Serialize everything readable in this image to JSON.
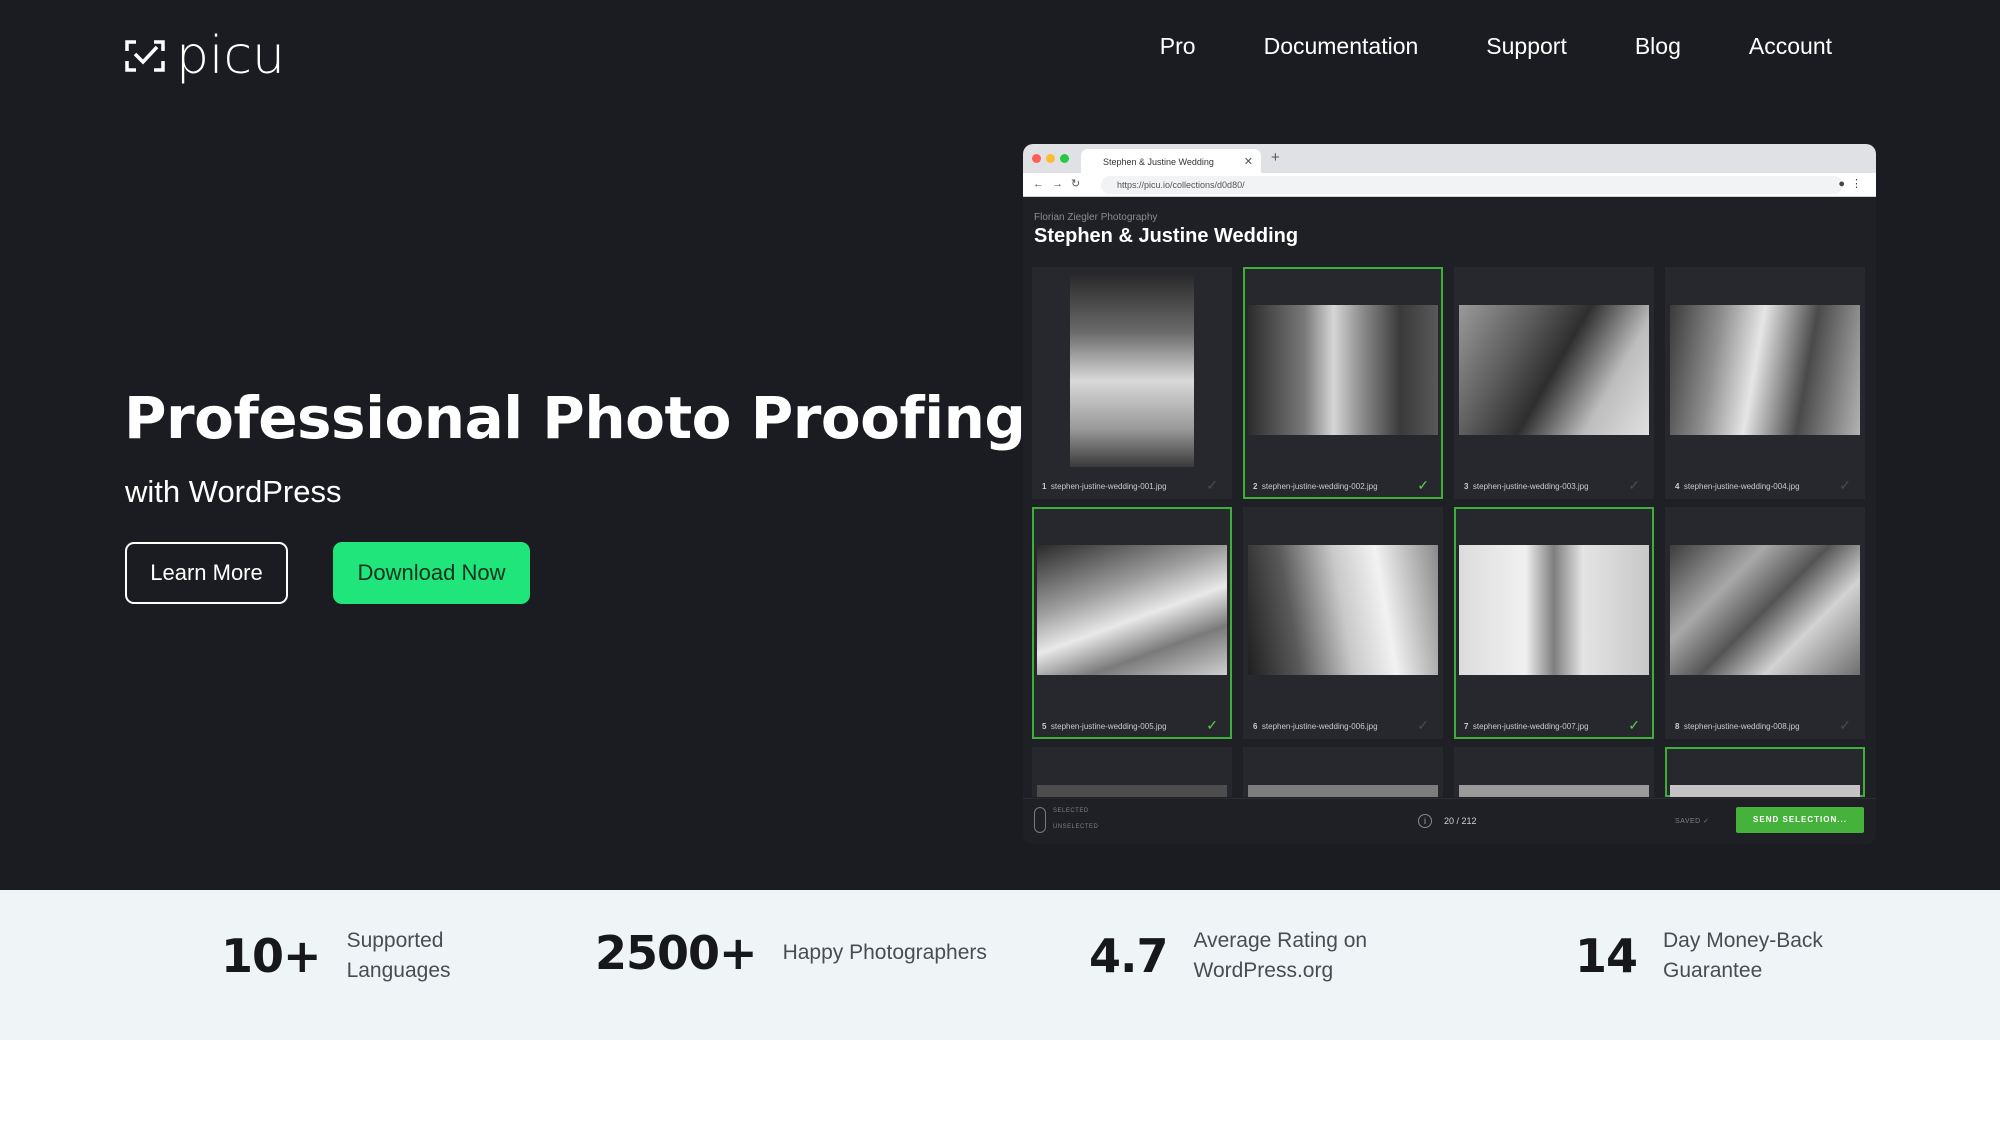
{
  "header": {
    "logo_text": "picu",
    "nav": [
      "Pro",
      "Documentation",
      "Support",
      "Blog",
      "Account"
    ]
  },
  "hero": {
    "title": "Professional Photo Proofing",
    "subtitle": "with WordPress",
    "learn_more": "Learn More",
    "download": "Download Now"
  },
  "browser": {
    "tab_title": "Stephen & Justine Wedding",
    "url": "https://picu.io/collections/d0d80/",
    "gallery_eyebrow": "Florian Ziegler Photography",
    "gallery_title": "Stephen & Justine Wedding",
    "photos": [
      {
        "n": "1",
        "file": "stephen-justine-wedding-001.jpg",
        "selected": false
      },
      {
        "n": "2",
        "file": "stephen-justine-wedding-002.jpg",
        "selected": true
      },
      {
        "n": "3",
        "file": "stephen-justine-wedding-003.jpg",
        "selected": false
      },
      {
        "n": "4",
        "file": "stephen-justine-wedding-004.jpg",
        "selected": false
      },
      {
        "n": "5",
        "file": "stephen-justine-wedding-005.jpg",
        "selected": true
      },
      {
        "n": "6",
        "file": "stephen-justine-wedding-006.jpg",
        "selected": false
      },
      {
        "n": "7",
        "file": "stephen-justine-wedding-007.jpg",
        "selected": true
      },
      {
        "n": "8",
        "file": "stephen-justine-wedding-008.jpg",
        "selected": false
      }
    ],
    "footer": {
      "legend_selected": "SELECTED",
      "legend_unselected": "UNSELECTED",
      "count": "20 / 212",
      "saved": "SAVED ✓",
      "send": "SEND SELECTION..."
    }
  },
  "stats": [
    {
      "num": "10+",
      "label": "Supported Languages"
    },
    {
      "num": "2500+",
      "label": "Happy Photographers"
    },
    {
      "num": "4.7",
      "label": "Average Rating on WordPress.org"
    },
    {
      "num": "14",
      "label": "Day Money-Back Guarantee"
    }
  ],
  "colors": {
    "hero_bg": "#1b1c22",
    "accent_green": "#1fe57a",
    "selected_border": "#3fae3a",
    "stats_bg": "#eff4f7"
  }
}
